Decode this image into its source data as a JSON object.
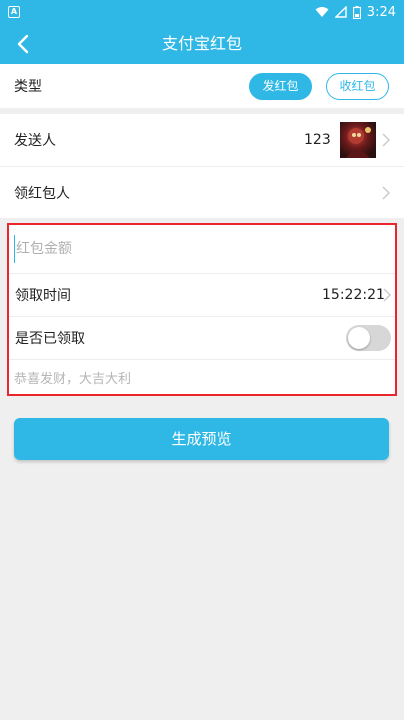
{
  "status_bar": {
    "time": "3:24",
    "app_icon_letter": "A",
    "icons": [
      "wifi-icon",
      "signal-icon",
      "battery-icon"
    ]
  },
  "app_bar": {
    "title": "支付宝红包",
    "back_icon": "chevron-left-icon"
  },
  "type_row": {
    "label": "类型",
    "options": [
      {
        "label": "发红包",
        "selected": true
      },
      {
        "label": "收红包",
        "selected": false
      }
    ]
  },
  "sender_row": {
    "label": "发送人",
    "value": "123"
  },
  "receiver_row": {
    "label": "领红包人"
  },
  "form": {
    "amount_placeholder": "红包金额",
    "time_label": "领取时间",
    "time_value": "15:22:21",
    "claimed_label": "是否已领取",
    "claimed": false,
    "wish_placeholder": "恭喜发财，大吉大利"
  },
  "generate_button": {
    "label": "生成预览"
  },
  "colors": {
    "accent": "#2fb8e6",
    "highlight_border": "#e8262c",
    "background": "#efefef"
  }
}
